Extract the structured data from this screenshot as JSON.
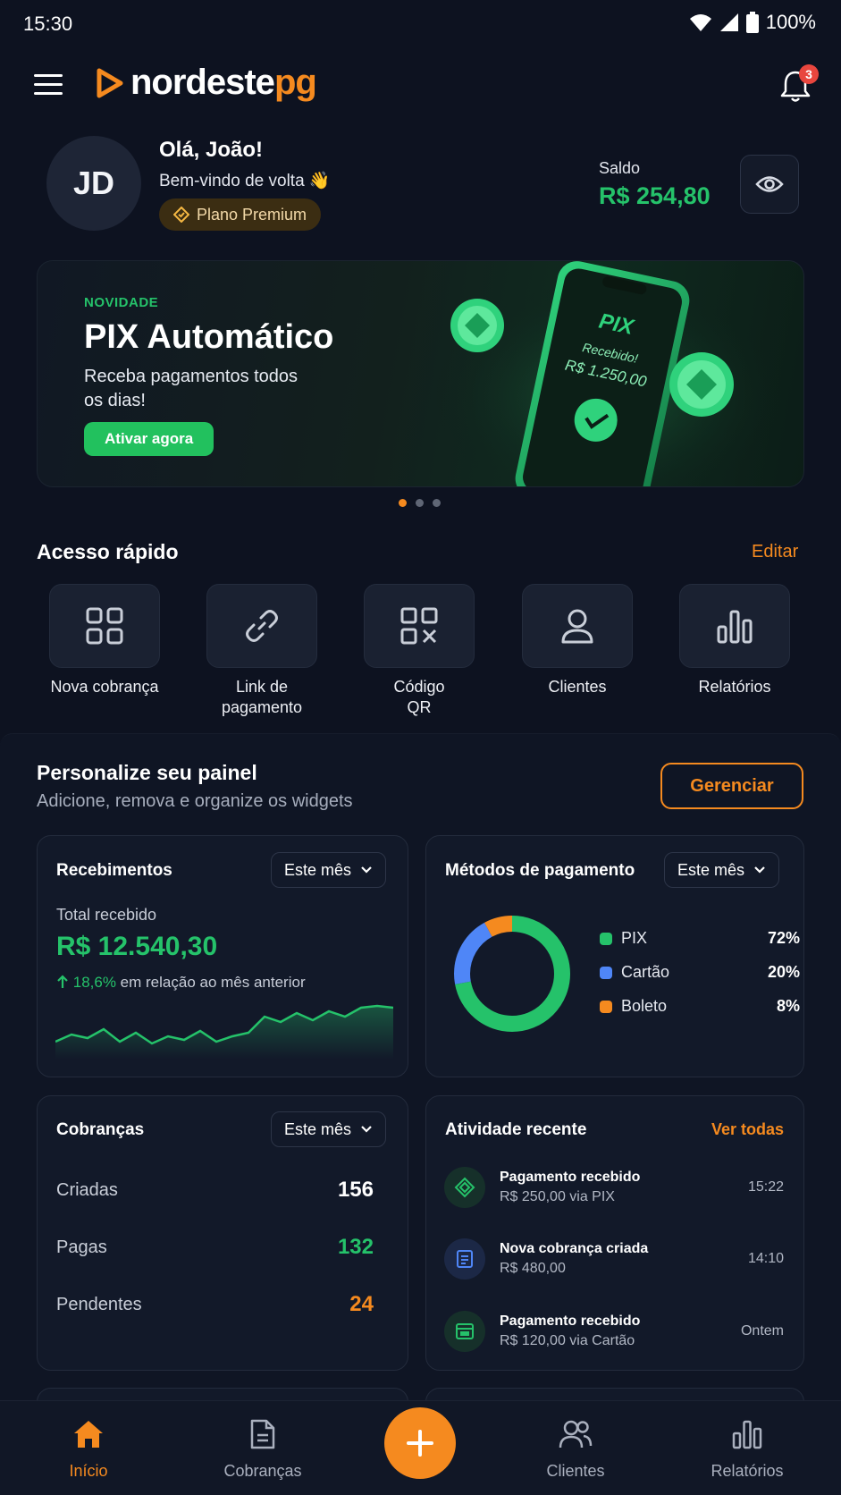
{
  "status_bar": {
    "time": "15:30",
    "battery": "100%"
  },
  "header": {
    "logo_part1": "nordeste",
    "logo_part2": "pg",
    "notification_count": "3"
  },
  "profile": {
    "initials": "JD",
    "greeting": "Olá, João!",
    "welcome": "Bem-vindo de volta 👋",
    "plan": "Plano Premium",
    "balance_label": "Saldo",
    "balance_value": "R$ 254,80"
  },
  "banner": {
    "tag": "NOVIDADE",
    "title": "PIX Automático",
    "description": "Receba pagamentos todos os dias!",
    "cta": "Ativar agora",
    "phone_title": "PIX",
    "phone_status": "Recebido!",
    "phone_amount": "R$ 1.250,00",
    "slide_count": 3,
    "active_slide": 1
  },
  "quick_access": {
    "title": "Acesso rápido",
    "edit": "Editar",
    "items": [
      {
        "label": "Nova cobrança",
        "icon": "grid-icon"
      },
      {
        "label": "Link de pagamento",
        "icon": "link-icon"
      },
      {
        "label": "Código QR",
        "icon": "qr-code-icon"
      },
      {
        "label": "Clientes",
        "icon": "user-icon"
      },
      {
        "label": "Relatórios",
        "icon": "bar-chart-icon"
      }
    ]
  },
  "personalize": {
    "title": "Personalize seu painel",
    "subtitle": "Adicione, remova e organize os widgets",
    "manage": "Gerenciar"
  },
  "widgets": {
    "receipts": {
      "title": "Recebimentos",
      "period": "Este mês",
      "total_label": "Total recebido",
      "total_value": "R$ 12.540,30",
      "trend_pct": "18,6%",
      "trend_text": "em relação ao mês anterior"
    },
    "payment_methods": {
      "title": "Métodos de pagamento",
      "period": "Este mês",
      "items": [
        {
          "name": "PIX",
          "pct": "72%",
          "value": 72,
          "color": "#25c26a"
        },
        {
          "name": "Cartão",
          "pct": "20%",
          "value": 20,
          "color": "#4f86f7"
        },
        {
          "name": "Boleto",
          "pct": "8%",
          "value": 8,
          "color": "#f58a1f"
        }
      ]
    },
    "charges": {
      "title": "Cobranças",
      "period": "Este mês",
      "rows": [
        {
          "label": "Criadas",
          "value": "156",
          "color": "#ffffff"
        },
        {
          "label": "Pagas",
          "value": "132",
          "color": "#25c26a"
        },
        {
          "label": "Pendentes",
          "value": "24",
          "color": "#f58a1f"
        }
      ]
    },
    "activity": {
      "title": "Atividade recente",
      "see_all": "Ver todas",
      "items": [
        {
          "title": "Pagamento recebido",
          "subtitle": "R$ 250,00 via PIX",
          "time": "15:22",
          "icon": "pix-icon"
        },
        {
          "title": "Nova cobrança criada",
          "subtitle": "R$ 480,00",
          "time": "14:10",
          "icon": "invoice-icon"
        },
        {
          "title": "Pagamento recebido",
          "subtitle": "R$ 120,00 via Cartão",
          "time": "Ontem",
          "icon": "card-payment-icon"
        }
      ]
    }
  },
  "bottom_nav": {
    "items": [
      {
        "label": "Início",
        "icon": "home-icon",
        "active": true
      },
      {
        "label": "Cobranças",
        "icon": "document-icon",
        "active": false
      },
      {
        "label": "Clientes",
        "icon": "users-icon",
        "active": false
      },
      {
        "label": "Relatórios",
        "icon": "bar-chart-icon",
        "active": false
      }
    ]
  },
  "colors": {
    "accent": "#f58a1f",
    "success": "#25c26a",
    "background": "#0d1220"
  }
}
